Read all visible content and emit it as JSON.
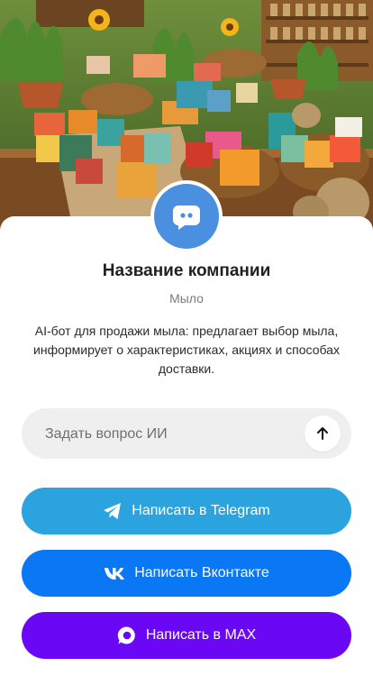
{
  "hero": {
    "image": "soap-market-stall-illustration"
  },
  "company": {
    "name": "Название компании",
    "category": "Мыло",
    "description": "AI-бот для продажи мыла: предлагает выбор мыла, информирует о характеристиках, акциях и способах доставки.",
    "avatar_icon": "chat-bubble-icon",
    "avatar_color": "#4a8fe0"
  },
  "ask": {
    "placeholder": "Задать вопрос ИИ",
    "send_icon": "arrow-up-icon"
  },
  "actions": [
    {
      "label": "Написать в Telegram",
      "icon": "telegram-icon",
      "color": "#2aa3df"
    },
    {
      "label": "Написать Вконтакте",
      "icon": "vk-icon",
      "color": "#0a77f5"
    },
    {
      "label": "Написать в MAX",
      "icon": "max-icon",
      "color": "#6a08f6"
    }
  ]
}
